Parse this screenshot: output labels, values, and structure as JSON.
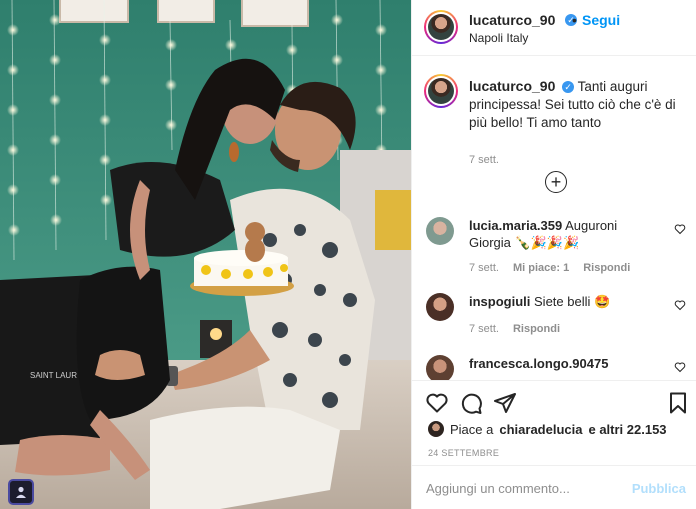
{
  "post": {
    "photo_alt": "",
    "header": {
      "username": "lucaturco_90",
      "separator": "•",
      "follow_label": "Segui",
      "location": "Napoli Italy"
    },
    "caption": {
      "username": "lucaturco_90",
      "text": "Tanti auguri principessa! Sei tutto ciò che c'è di più bello! Ti amo tanto",
      "time": "7 sett."
    },
    "comments": [
      {
        "username": "lucia.maria.359",
        "text": "Auguroni Giorgia 🍾🎉🎉🎉",
        "time": "7 sett.",
        "likes": "Mi piace: 1",
        "reply": "Rispondi",
        "avatar_color": "#8aa59a"
      },
      {
        "username": "inspogiuli",
        "text": "Siete belli 🤩",
        "time": "7 sett.",
        "reply": "Rispondi",
        "avatar_color": "#5a3a30"
      },
      {
        "username": "francesca.longo.90475",
        "text": "",
        "avatar_color": "#6b4a3c"
      }
    ],
    "likes_text_prefix": "Piace a",
    "likes_user": "chiaradelucia",
    "likes_text_suffix": "e altri 22.153",
    "date": "24 SETTEMBRE",
    "comment_placeholder": "Aggiungi un commento...",
    "publish_label": "Pubblica",
    "accent_color": "#0095f6"
  }
}
